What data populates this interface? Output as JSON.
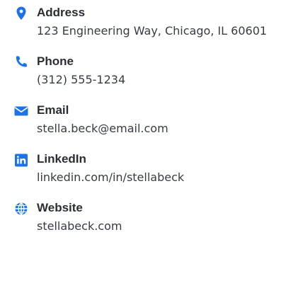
{
  "contact": {
    "items": [
      {
        "icon": "location-pin-icon",
        "title": "Address",
        "value": "123 Engineering Way, Chicago, IL 60601"
      },
      {
        "icon": "phone-icon",
        "title": "Phone",
        "value": "(312) 555-1234"
      },
      {
        "icon": "email-icon",
        "title": "Email",
        "value": "stella.beck@email.com"
      },
      {
        "icon": "linkedin-icon",
        "title": "LinkedIn",
        "value": "linkedin.com/in/stellabeck"
      },
      {
        "icon": "globe-icon",
        "title": "Website",
        "value": "stellabeck.com"
      }
    ]
  },
  "colors": {
    "accent": "#1a73e8",
    "title_text": "#2a2d34",
    "body_text": "#363b45",
    "background": "#ffffff"
  }
}
